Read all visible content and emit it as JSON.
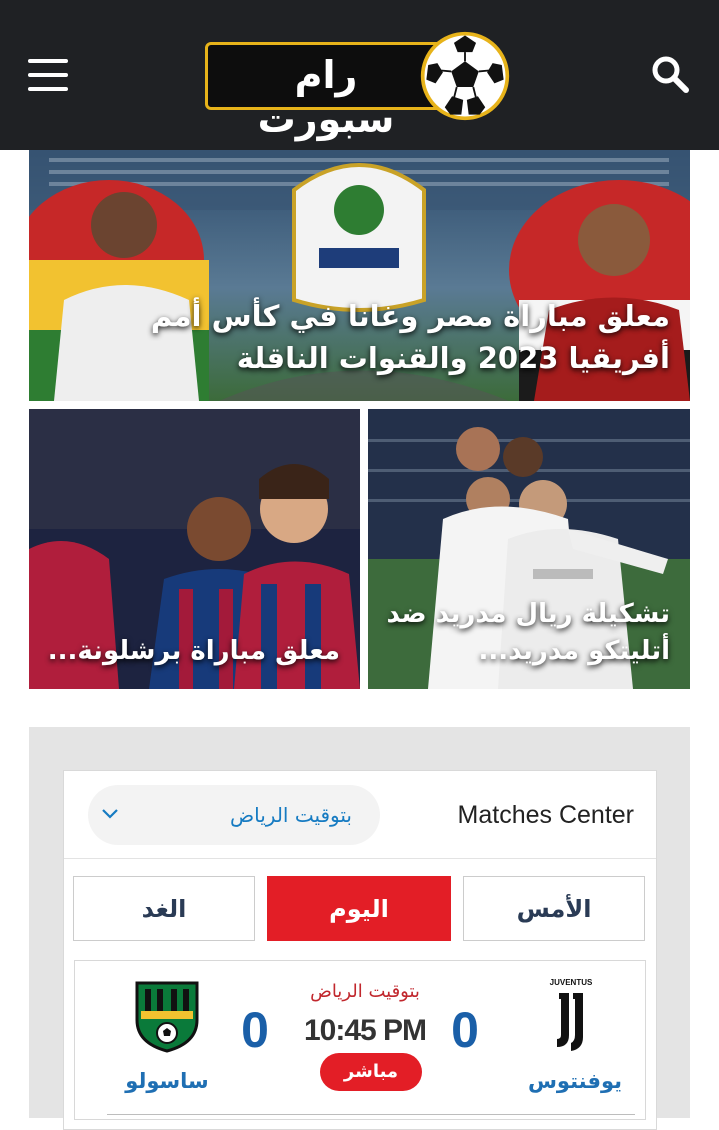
{
  "header": {
    "logo_text": "رام سبورت",
    "menu_icon": "hamburger-menu-icon",
    "search_icon": "search-icon",
    "background_color": "#1f2124",
    "logo_border_color": "#e7b31a"
  },
  "featured": {
    "title": "معلق مباراة مصر وغانا في كأس أمم أفريقيا 2023 والقنوات الناقلة"
  },
  "cards": [
    {
      "title": "معلق مباراة برشلونة..."
    },
    {
      "title": "تشكيلة ريال مدريد ضد أتليتكو مدريد..."
    }
  ],
  "matches_center": {
    "title": "Matches Center",
    "timezone_label": "بتوقيت الرياض",
    "tabs": {
      "yesterday": "الأمس",
      "today": "اليوم",
      "tomorrow": "الغد"
    },
    "active_tab": "today",
    "accent_color": "#e31e26",
    "match": {
      "home_team": "يوفنتوس",
      "away_team": "ساسولو",
      "home_score": "0",
      "away_score": "0",
      "timezone": "بتوقيت الرياض",
      "time": "10:45 PM",
      "status": "مباشر"
    }
  }
}
